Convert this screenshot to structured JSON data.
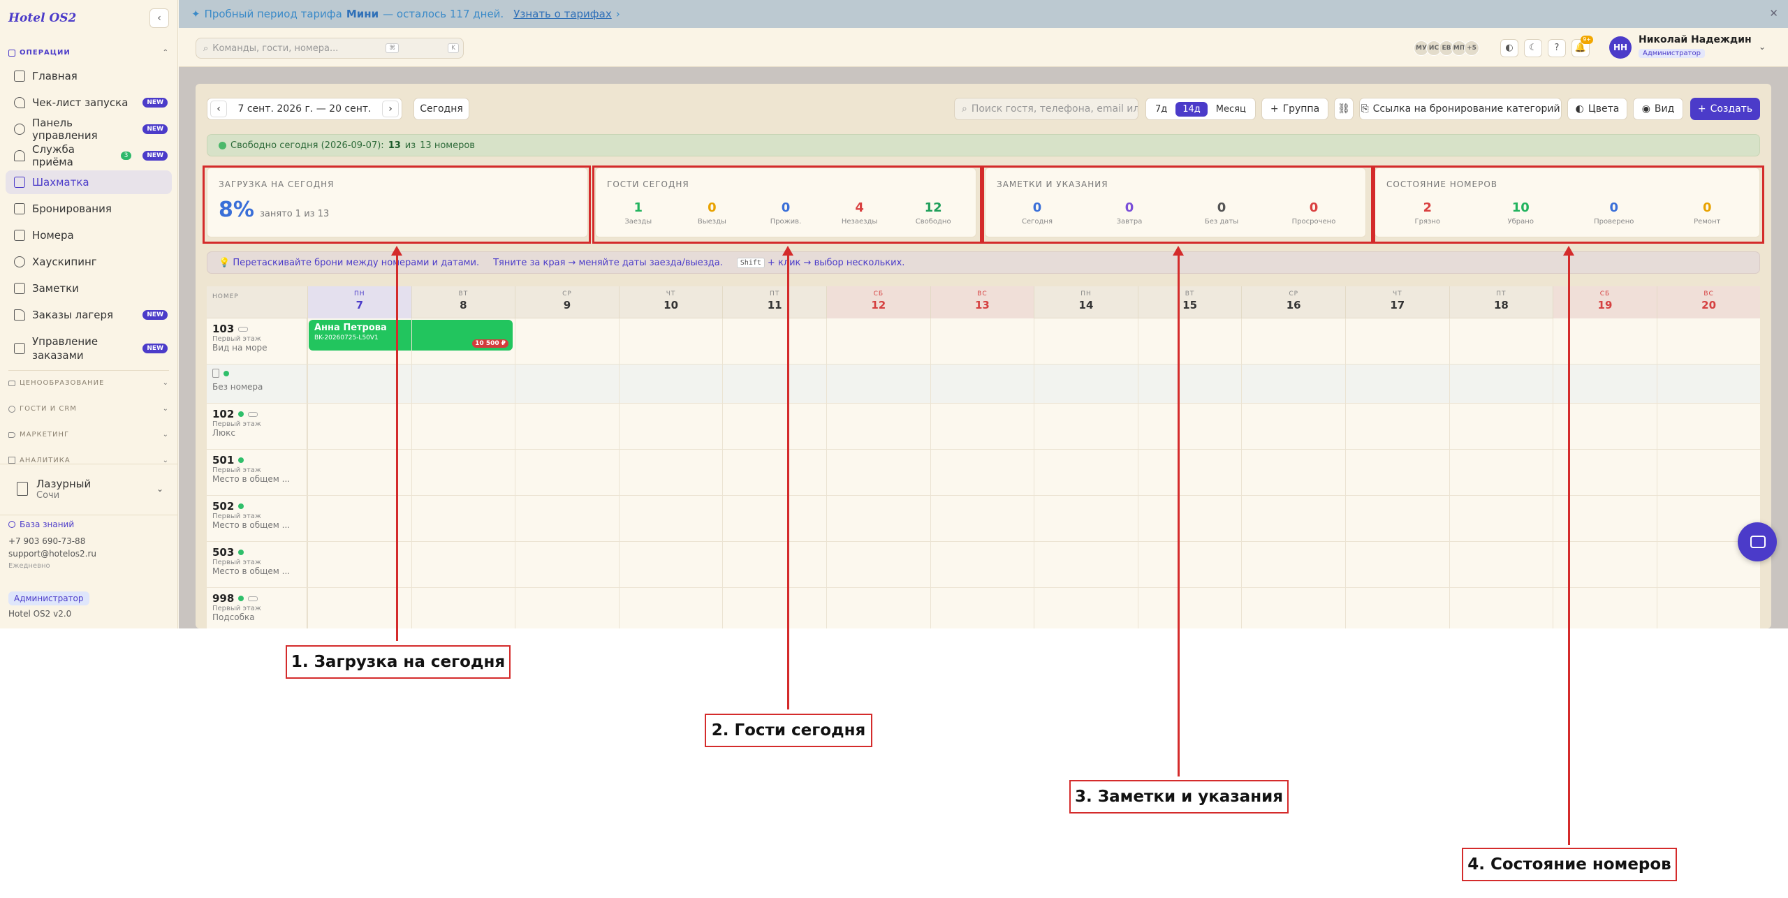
{
  "app": {
    "logo": "Hotel OS2",
    "version": "Hotel OS2 v2.0"
  },
  "sidebar": {
    "section_ops": "ОПЕРАЦИИ",
    "items": [
      {
        "label": "Главная"
      },
      {
        "label": "Чек-лист запуска",
        "badge": "NEW"
      },
      {
        "label": "Панель управления",
        "badge": "NEW"
      },
      {
        "label": "Служба приёма",
        "count": "3",
        "badge": "NEW"
      },
      {
        "label": "Шахматка"
      },
      {
        "label": "Бронирования"
      },
      {
        "label": "Номера"
      },
      {
        "label": "Хаускипинг"
      },
      {
        "label": "Заметки"
      },
      {
        "label": "Заказы лагеря",
        "badge": "NEW"
      },
      {
        "label": "Управление\nзаказами",
        "badge": "NEW"
      }
    ],
    "sections": [
      "ЦЕНООБРАЗОВАНИЕ",
      "ГОСТИ И CRM",
      "МАРКЕТИНГ",
      "АНАЛИТИКА"
    ],
    "hotel_name": "Лазурный",
    "hotel_city": "Сочи",
    "kb_label": "База знаний",
    "phone": "+7 903 690-73-88",
    "email": "support@hotelos2.ru",
    "hours": "Ежедневно",
    "role": "Администратор"
  },
  "trial": {
    "text_before": "Пробный период тарифа",
    "plan": "Мини",
    "text_after": "— осталось 117 дней.",
    "link": "Узнать о тарифах"
  },
  "header": {
    "search_placeholder": "Команды, гости, номера...",
    "kbd1": "⌘",
    "kbd2": "K",
    "avatars": [
      "МУ",
      "ИС",
      "ЕВ",
      "МП",
      "+5"
    ],
    "notif_count": "9+",
    "user_initials": "НН",
    "user_name": "Николай Надеждин",
    "user_role": "Администратор"
  },
  "toolbar": {
    "date_range": "7 сент. 2026 г. — 20 сент.",
    "today": "Сегодня",
    "guest_search_placeholder": "Поиск гостя, телефона, email или",
    "views": [
      "7д",
      "14д",
      "Месяц"
    ],
    "active_view": "14д",
    "group": "Группа",
    "booking_link": "Ссылка на бронирование категорий",
    "colors": "Цвета",
    "view": "Вид",
    "create": "Создать"
  },
  "free_banner": {
    "prefix": "Свободно сегодня (2026-09-07):",
    "free": "13",
    "mid": "из",
    "total": "13 номеров"
  },
  "stats": {
    "load": {
      "title": "ЗАГРУЗКА НА СЕГОДНЯ",
      "pct": "8%",
      "sub": "занято 1 из 13"
    },
    "guests": {
      "title": "ГОСТИ СЕГОДНЯ",
      "items": [
        {
          "value": "1",
          "label": "Заезды",
          "color": "#22b35e"
        },
        {
          "value": "0",
          "label": "Выезды",
          "color": "#e8a200"
        },
        {
          "value": "0",
          "label": "Прожив.",
          "color": "#3a6fd8"
        },
        {
          "value": "4",
          "label": "Незаезды",
          "color": "#d94040"
        },
        {
          "value": "12",
          "label": "Свободно",
          "color": "#1f9f5a"
        }
      ]
    },
    "notes": {
      "title": "ЗАМЕТКИ И УКАЗАНИЯ",
      "items": [
        {
          "value": "0",
          "label": "Сегодня",
          "color": "#3a6fd8"
        },
        {
          "value": "0",
          "label": "Завтра",
          "color": "#7b4fd8"
        },
        {
          "value": "0",
          "label": "Без даты",
          "color": "#555555"
        },
        {
          "value": "0",
          "label": "Просрочено",
          "color": "#d94040"
        }
      ]
    },
    "rooms": {
      "title": "СОСТОЯНИЕ НОМЕРОВ",
      "items": [
        {
          "value": "2",
          "label": "Грязно",
          "color": "#d94040"
        },
        {
          "value": "10",
          "label": "Убрано",
          "color": "#22b35e"
        },
        {
          "value": "0",
          "label": "Проверено",
          "color": "#3a6fd8"
        },
        {
          "value": "0",
          "label": "Ремонт",
          "color": "#e8a200"
        }
      ]
    }
  },
  "hint": {
    "drag": "💡 Перетаскивайте брони между номерами и датами.",
    "resize": "Тяните за края → меняйте даты заезда/выезда.",
    "kbd": "Shift",
    "multi": "+ клик → выбор нескольких."
  },
  "grid": {
    "room_header": "НОМЕР",
    "days": [
      {
        "dow": "ПН",
        "day": "7",
        "type": "today"
      },
      {
        "dow": "ВТ",
        "day": "8",
        "type": ""
      },
      {
        "dow": "СР",
        "day": "9",
        "type": ""
      },
      {
        "dow": "ЧТ",
        "day": "10",
        "type": ""
      },
      {
        "dow": "ПТ",
        "day": "11",
        "type": ""
      },
      {
        "dow": "СБ",
        "day": "12",
        "type": "wk"
      },
      {
        "dow": "ВС",
        "day": "13",
        "type": "wk"
      },
      {
        "dow": "ПН",
        "day": "14",
        "type": ""
      },
      {
        "dow": "ВТ",
        "day": "15",
        "type": ""
      },
      {
        "dow": "СР",
        "day": "16",
        "type": ""
      },
      {
        "dow": "ЧТ",
        "day": "17",
        "type": ""
      },
      {
        "dow": "ПТ",
        "day": "18",
        "type": ""
      },
      {
        "dow": "СБ",
        "day": "19",
        "type": "wk"
      },
      {
        "dow": "ВС",
        "day": "20",
        "type": "wk"
      }
    ],
    "rooms": [
      {
        "num": "103",
        "floor": "Первый этаж",
        "type": "Вид на море",
        "dot": false,
        "pill": true
      },
      {
        "num": "",
        "floor": "",
        "type": "Без номера",
        "dot": true,
        "pill": false
      },
      {
        "num": "102",
        "floor": "Первый этаж",
        "type": "Люкс",
        "dot": true,
        "pill": true
      },
      {
        "num": "501",
        "floor": "Первый этаж",
        "type": "Место в общем ...",
        "dot": true,
        "pill": false
      },
      {
        "num": "502",
        "floor": "Первый этаж",
        "type": "Место в общем ...",
        "dot": true,
        "pill": false
      },
      {
        "num": "503",
        "floor": "Первый этаж",
        "type": "Место в общем ...",
        "dot": true,
        "pill": false
      },
      {
        "num": "998",
        "floor": "Первый этаж",
        "type": "Подсобка",
        "dot": true,
        "pill": true
      }
    ],
    "booking": {
      "guest": "Анна Петрова",
      "code": "BK-20260725-L50V1",
      "price": "10 500 ₽"
    }
  },
  "annotations": [
    {
      "label": "1. Загрузка на сегодня"
    },
    {
      "label": "2. Гости сегодня"
    },
    {
      "label": "3. Заметки и указания"
    },
    {
      "label": "4. Состояние номеров"
    }
  ],
  "colors": {
    "accent": "#4b3bc9",
    "annotation": "#d42b2b"
  }
}
